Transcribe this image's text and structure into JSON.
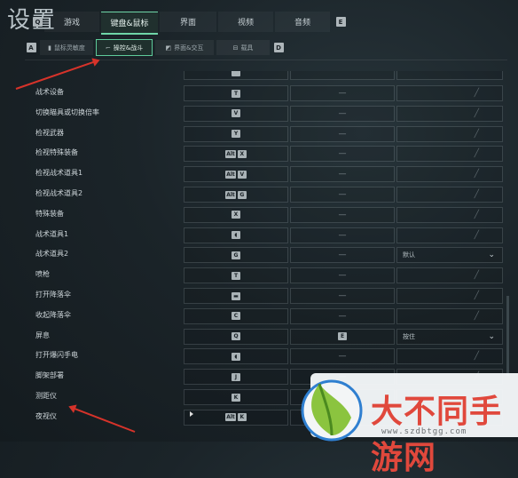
{
  "title": "设置",
  "tabs": {
    "key_left": "Q",
    "key_right": "E",
    "items": [
      {
        "label": "游戏"
      },
      {
        "label": "键盘&鼠标",
        "active": true
      },
      {
        "label": "界面"
      },
      {
        "label": "视频"
      },
      {
        "label": "音频"
      }
    ]
  },
  "subtabs": {
    "key_left": "A",
    "key_right": "D",
    "items": [
      {
        "label": "鼠标灵敏度",
        "icon": "mouse-icon"
      },
      {
        "label": "操控&战斗",
        "icon": "gun-icon",
        "active": true
      },
      {
        "label": "界面&交互",
        "icon": "interface-icon"
      },
      {
        "label": "载具",
        "icon": "vehicle-icon"
      }
    ]
  },
  "rows": [
    {
      "label": "战术设备",
      "keys": [
        "T"
      ],
      "alt": "—",
      "option": ""
    },
    {
      "label": "切换瞄具或切换倍率",
      "keys": [
        "V"
      ],
      "alt": "—",
      "option": ""
    },
    {
      "label": "检视武器",
      "keys": [
        "Y"
      ],
      "alt": "—",
      "option": ""
    },
    {
      "label": "检视特殊装备",
      "keys": [
        "Alt",
        "X"
      ],
      "alt": "—",
      "option": ""
    },
    {
      "label": "检视战术道具1",
      "keys": [
        "Alt",
        "V"
      ],
      "alt": "—",
      "option": ""
    },
    {
      "label": "检视战术道具2",
      "keys": [
        "Alt",
        "G"
      ],
      "alt": "—",
      "option": ""
    },
    {
      "label": "特殊装备",
      "keys": [
        "X"
      ],
      "alt": "—",
      "option": ""
    },
    {
      "label": "战术道具1",
      "keys": [
        "◖"
      ],
      "alt": "—",
      "option": ""
    },
    {
      "label": "战术道具2",
      "keys": [
        "G"
      ],
      "alt": "—",
      "option": "默认"
    },
    {
      "label": "喷枪",
      "keys": [
        "T"
      ],
      "alt": "—",
      "option": ""
    },
    {
      "label": "打开降落伞",
      "keys": [
        "▬"
      ],
      "alt": "—",
      "option": ""
    },
    {
      "label": "收起降落伞",
      "keys": [
        "C"
      ],
      "alt": "—",
      "option": ""
    },
    {
      "label": "屏息",
      "keys": [
        "Q"
      ],
      "alt": "E",
      "option": "按住"
    },
    {
      "label": "打开爆闪手电",
      "keys": [
        "◖"
      ],
      "alt": "—",
      "option": ""
    },
    {
      "label": "脚架部署",
      "keys": [
        "J"
      ],
      "alt": "—",
      "option": ""
    },
    {
      "label": "测距仪",
      "keys": [
        "K"
      ],
      "alt": "—",
      "option": ""
    },
    {
      "label": "夜视仪",
      "keys": [
        "Alt",
        "K"
      ],
      "alt": "—",
      "option": ""
    }
  ],
  "watermark": {
    "text": "大不同手游网",
    "url": "www.szdbtgg.com"
  },
  "colors": {
    "accent": "#6fd6a8",
    "arrow": "#d6332a",
    "watermark_text": "#e0483c"
  }
}
